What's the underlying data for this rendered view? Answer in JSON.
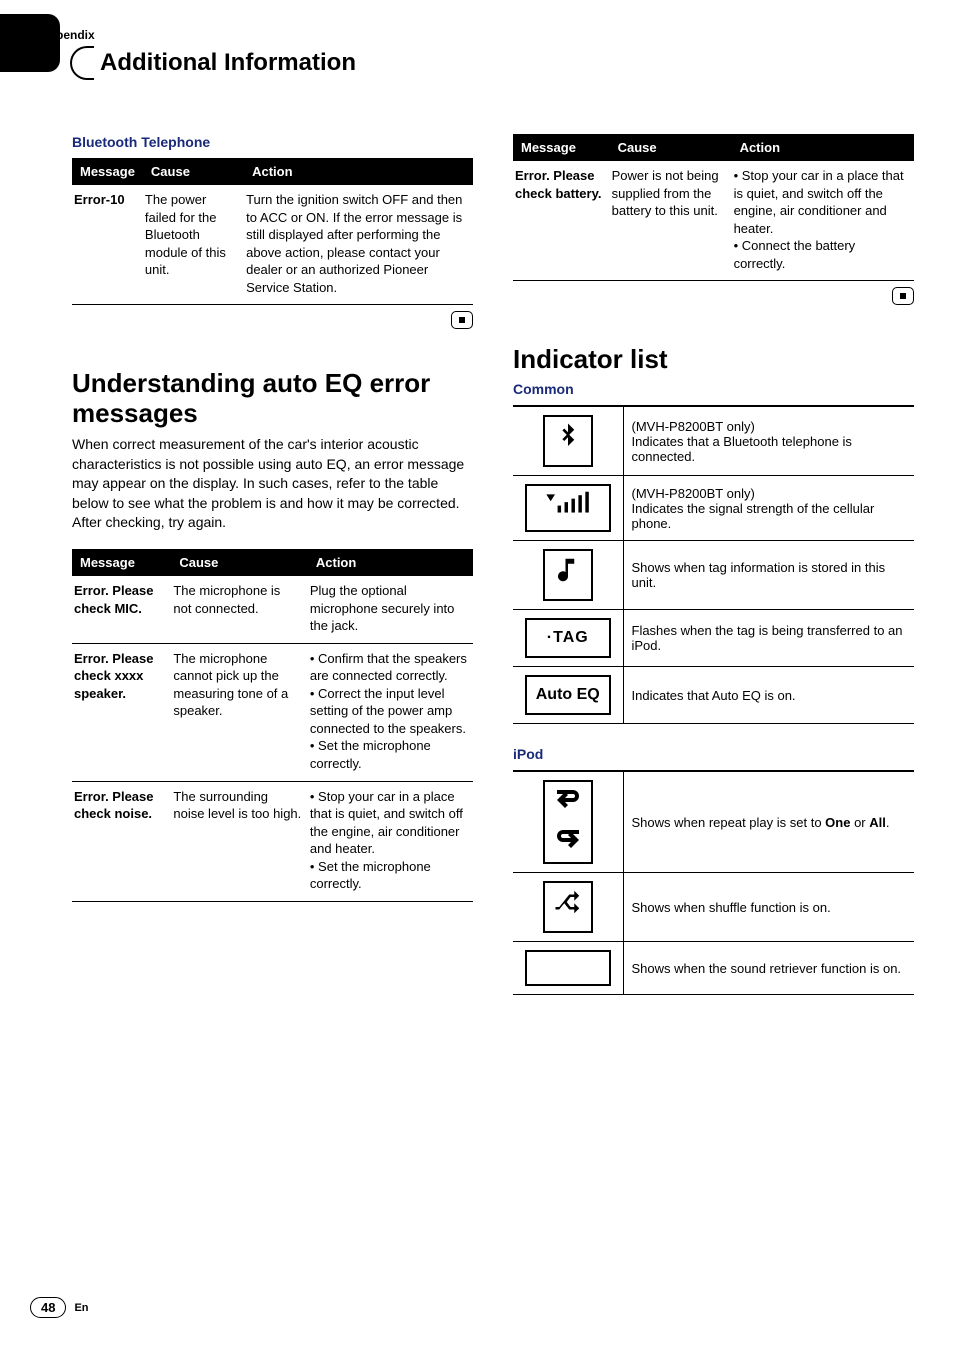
{
  "header": {
    "appendix": "Appendix",
    "title": "Additional Information"
  },
  "left": {
    "bt_heading": "Bluetooth Telephone",
    "th": {
      "message": "Message",
      "cause": "Cause",
      "action": "Action"
    },
    "bt_rows": [
      {
        "message": "Error-10",
        "cause": "The power failed for the Bluetooth module of this unit.",
        "action": "Turn the ignition switch OFF and then to ACC or ON. If the error message is still displayed after performing the above action, please contact your dealer or an authorized Pioneer Service Station."
      }
    ],
    "eq_heading": "Understanding auto EQ error messages",
    "eq_body": "When correct measurement of the car's interior acoustic characteristics is not possible using auto EQ, an error message may appear on the display. In such cases, refer to the table below to see what the problem is and how it may be corrected. After checking, try again.",
    "eq_rows": [
      {
        "message": "Error. Please check MIC.",
        "cause": "The microphone is not connected.",
        "action": "Plug the optional microphone securely into the jack."
      },
      {
        "message": "Error. Please check xxxx speaker.",
        "cause": "The microphone cannot pick up the measuring tone of a speaker.",
        "action": "• Confirm that the speakers are connected correctly.\n• Correct the input level setting of the power amp connected to the speakers.\n• Set the microphone correctly."
      },
      {
        "message": "Error. Please check noise.",
        "cause": "The surrounding noise level is too high.",
        "action": "• Stop your car in a place that is quiet, and switch off the engine, air conditioner and heater.\n• Set the microphone correctly."
      }
    ]
  },
  "right": {
    "th": {
      "message": "Message",
      "cause": "Cause",
      "action": "Action"
    },
    "batt_rows": [
      {
        "message": "Error. Please check battery.",
        "cause": "Power is not being supplied from the battery to this unit.",
        "action": "• Stop your car in a place that is quiet, and switch off the engine, air conditioner and heater.\n• Connect the battery correctly."
      }
    ],
    "ind_heading": "Indicator list",
    "common_heading": "Common",
    "common_rows": [
      {
        "icon": "bt",
        "text": "(MVH-P8200BT only)\nIndicates that a Bluetooth telephone is connected."
      },
      {
        "icon": "signal",
        "text": "(MVH-P8200BT only)\nIndicates the signal strength of the cellular phone."
      },
      {
        "icon": "note",
        "text": "Shows when tag information is stored in this unit."
      },
      {
        "icon": "tag",
        "label": "·TAG",
        "text": "Flashes when the tag is being transferred to an iPod."
      },
      {
        "icon": "autoeq",
        "label": "Auto EQ",
        "text": "Indicates that Auto EQ is on."
      }
    ],
    "ipod_heading": "iPod",
    "ipod_rows": [
      {
        "icon": "repeat",
        "text_pre": "Shows when repeat play is set to ",
        "bold": "One",
        "mid": " or ",
        "bold2": "All",
        "suffix": "."
      },
      {
        "icon": "shuffle",
        "text": "Shows when shuffle function is on."
      },
      {
        "icon": "blank",
        "text": "Shows when the sound retriever function is on."
      }
    ]
  },
  "footer": {
    "page": "48",
    "lang": "En"
  }
}
